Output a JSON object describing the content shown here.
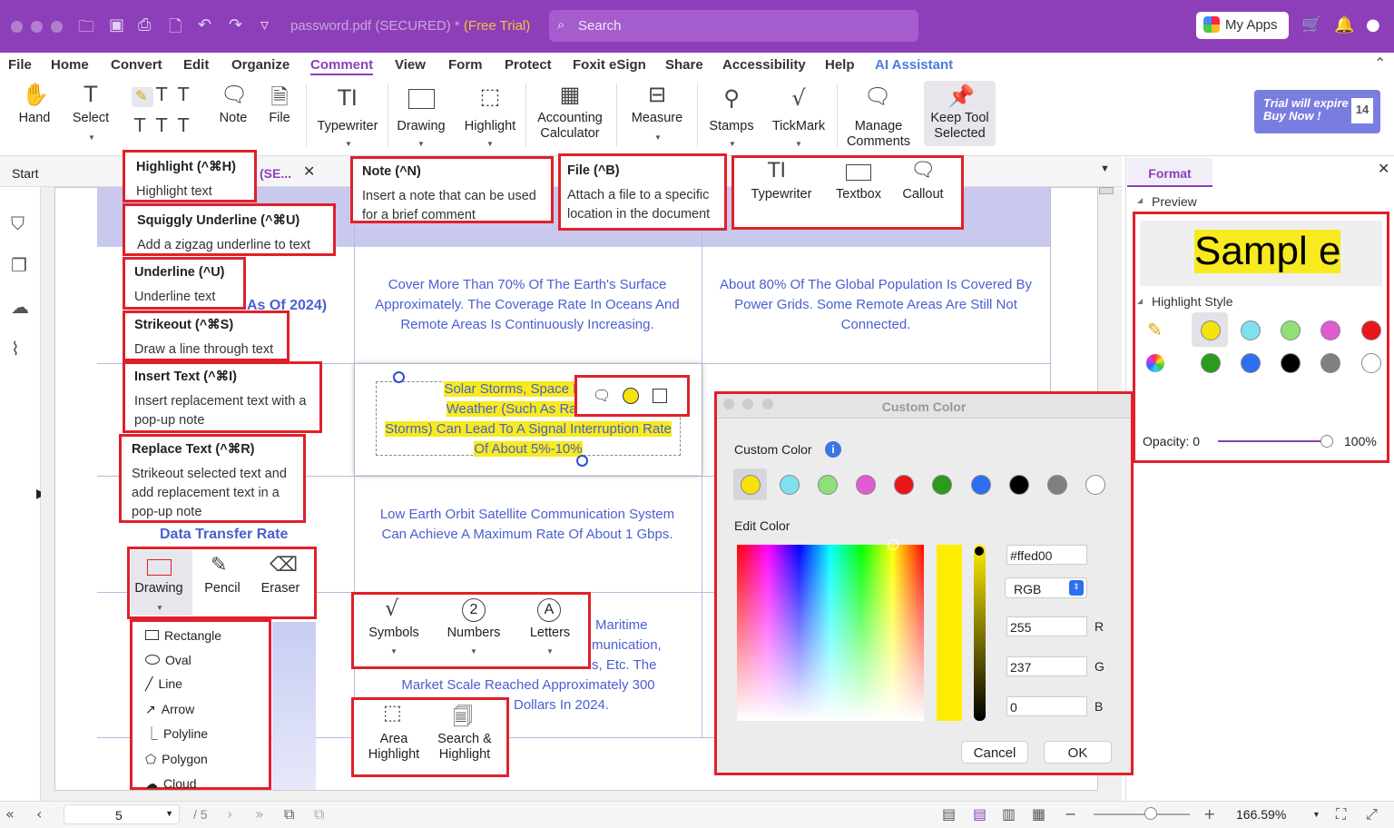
{
  "titlebar": {
    "doc_title": "password.pdf (SECURED) *",
    "trial": "(Free Trial)",
    "search_placeholder": "Search",
    "my_apps": "My Apps"
  },
  "menu": {
    "items": [
      "File",
      "Home",
      "Convert",
      "Edit",
      "Organize",
      "Comment",
      "View",
      "Form",
      "Protect",
      "Foxit eSign",
      "Share",
      "Accessibility",
      "Help",
      "AI Assistant"
    ],
    "active": "Comment"
  },
  "ribbon": {
    "hand": "Hand",
    "select": "Select",
    "note": "Note",
    "file": "File",
    "typewriter": "Typewriter",
    "drawing": "Drawing",
    "highlight": "Highlight",
    "accounting": "Accounting Calculator",
    "measure": "Measure",
    "stamps": "Stamps",
    "tickmark": "TickMark",
    "manage": "Manage Comments",
    "keep": "Keep Tool Selected",
    "trial_line1": "Trial will expire",
    "trial_line2": "Buy Now !",
    "trial_days": "14"
  },
  "tabs": {
    "start": "Start",
    "doc": "(SE..."
  },
  "tooltips": {
    "highlight": {
      "title": "Highlight (^⌘H)",
      "desc": "Highlight text"
    },
    "squiggly": {
      "title": "Squiggly Underline (^⌘U)",
      "desc": "Add a zigzag underline to text"
    },
    "underline": {
      "title": "Underline (^U)",
      "desc": "Underline text"
    },
    "strikeout": {
      "title": "Strikeout (^⌘S)",
      "desc": "Draw a line through text"
    },
    "insert": {
      "title": "Insert Text (^⌘I)",
      "desc": "Insert replacement text with a pop-up note"
    },
    "replace": {
      "title": "Replace Text (^⌘R)",
      "desc": "Strikeout selected text and add replacement text in a pop-up note"
    },
    "note": {
      "title": "Note (^N)",
      "desc": "Insert a note that can be used for a brief comment"
    },
    "file": {
      "title": "File (^B)",
      "desc": "Attach a file to a specific location in the document"
    }
  },
  "typewriter_menu": {
    "typewriter": "Typewriter",
    "textbox": "Textbox",
    "callout": "Callout"
  },
  "drawing_menu": {
    "drawing": "Drawing",
    "pencil": "Pencil",
    "eraser": "Eraser",
    "items": [
      "Rectangle",
      "Oval",
      "Line",
      "Arrow",
      "Polyline",
      "Polygon",
      "Cloud"
    ]
  },
  "symbols_menu": {
    "symbols": "Symbols",
    "numbers": "Numbers",
    "letters": "Letters"
  },
  "area_menu": {
    "area": "Area Highlight",
    "search": "Search & Highlight"
  },
  "document": {
    "left_frag1": "As Of 2024)",
    "left_frag2": "Data Transfer Rate",
    "cell1": "Cover More Than 70% Of The Earth's Surface Approximately. The Coverage Rate In Oceans And Remote Areas Is Continuously Increasing.",
    "cell2": "About 80% Of The Global Population Is Covered By Power Grids. Some Remote Areas Are Still Not Connected.",
    "hl_lines": [
      "Solar Storms, Space Debris",
      "Weather (Such As Rainstor",
      "Storms) Can Lead To A Signal Interruption Rate",
      "Of About 5%-10%"
    ],
    "cell3": "Low Earth Orbit Satellite Communication System Can Achieve A Maximum Rate Of About 1 Gbps.",
    "cell4_l1": "Maritime",
    "cell4_l2": "munication,",
    "cell4_l3": "s, Etc. The",
    "cell4_l4": "Market Scale Reached Approximately 300",
    "cell4_l5": "Dollars In 2024."
  },
  "format_panel": {
    "tab": "Format",
    "preview": "Preview",
    "sample": "Sampl e",
    "style": "Highlight Style",
    "opacity_label": "Opacity: 0",
    "opacity_max": "100%",
    "colors": [
      "#f5e20a",
      "#7ee0f0",
      "#8fe07a",
      "#e05ad0",
      "#e8161b",
      "#2a9b1c",
      "#2e6ef0",
      "#000000",
      "#808080",
      "#ffffff"
    ]
  },
  "dialog": {
    "title": "Custom Color",
    "custom": "Custom Color",
    "edit": "Edit Color",
    "hex": "#ffed00",
    "mode": "RGB",
    "r": "255",
    "g": "237",
    "b": "0",
    "r_label": "R",
    "g_label": "G",
    "b_label": "B",
    "cancel": "Cancel",
    "ok": "OK"
  },
  "status": {
    "page": "5",
    "total": "/ 5",
    "zoom": "166.59%"
  }
}
